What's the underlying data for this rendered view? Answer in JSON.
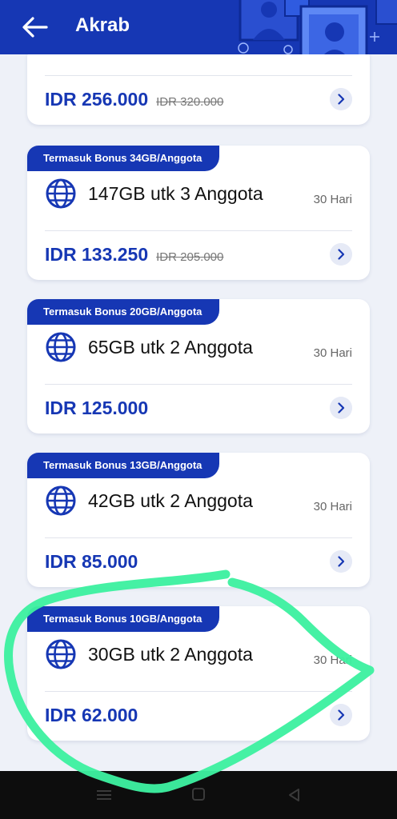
{
  "header": {
    "title": "Akrab",
    "back_icon": "arrow-left-icon",
    "background_color": "#1637b4"
  },
  "packages": [
    {
      "bonus": "",
      "name": "",
      "duration": "",
      "price": "IDR 256.000",
      "old_price": "IDR 320.000"
    },
    {
      "bonus": "Termasuk Bonus 34GB/Anggota",
      "name": "147GB utk 3 Anggota",
      "duration": "30 Hari",
      "price": "IDR 133.250",
      "old_price": "IDR 205.000"
    },
    {
      "bonus": "Termasuk Bonus 20GB/Anggota",
      "name": "65GB utk 2 Anggota",
      "duration": "30 Hari",
      "price": "IDR 125.000",
      "old_price": ""
    },
    {
      "bonus": "Termasuk Bonus 13GB/Anggota",
      "name": "42GB utk 2 Anggota",
      "duration": "30 Hari",
      "price": "IDR 85.000",
      "old_price": ""
    },
    {
      "bonus": "Termasuk Bonus 10GB/Anggota",
      "name": "30GB utk 2 Anggota",
      "duration": "30 Hari",
      "price": "IDR 62.000",
      "old_price": ""
    }
  ],
  "icons": {
    "package": "globe-icon",
    "action": "chevron-right-icon",
    "nav": [
      "menu-icon",
      "home-square-icon",
      "back-triangle-icon"
    ]
  },
  "colors": {
    "accent": "#1637b4",
    "highlight_stroke": "#3df0a0",
    "background": "#eef1f8"
  }
}
